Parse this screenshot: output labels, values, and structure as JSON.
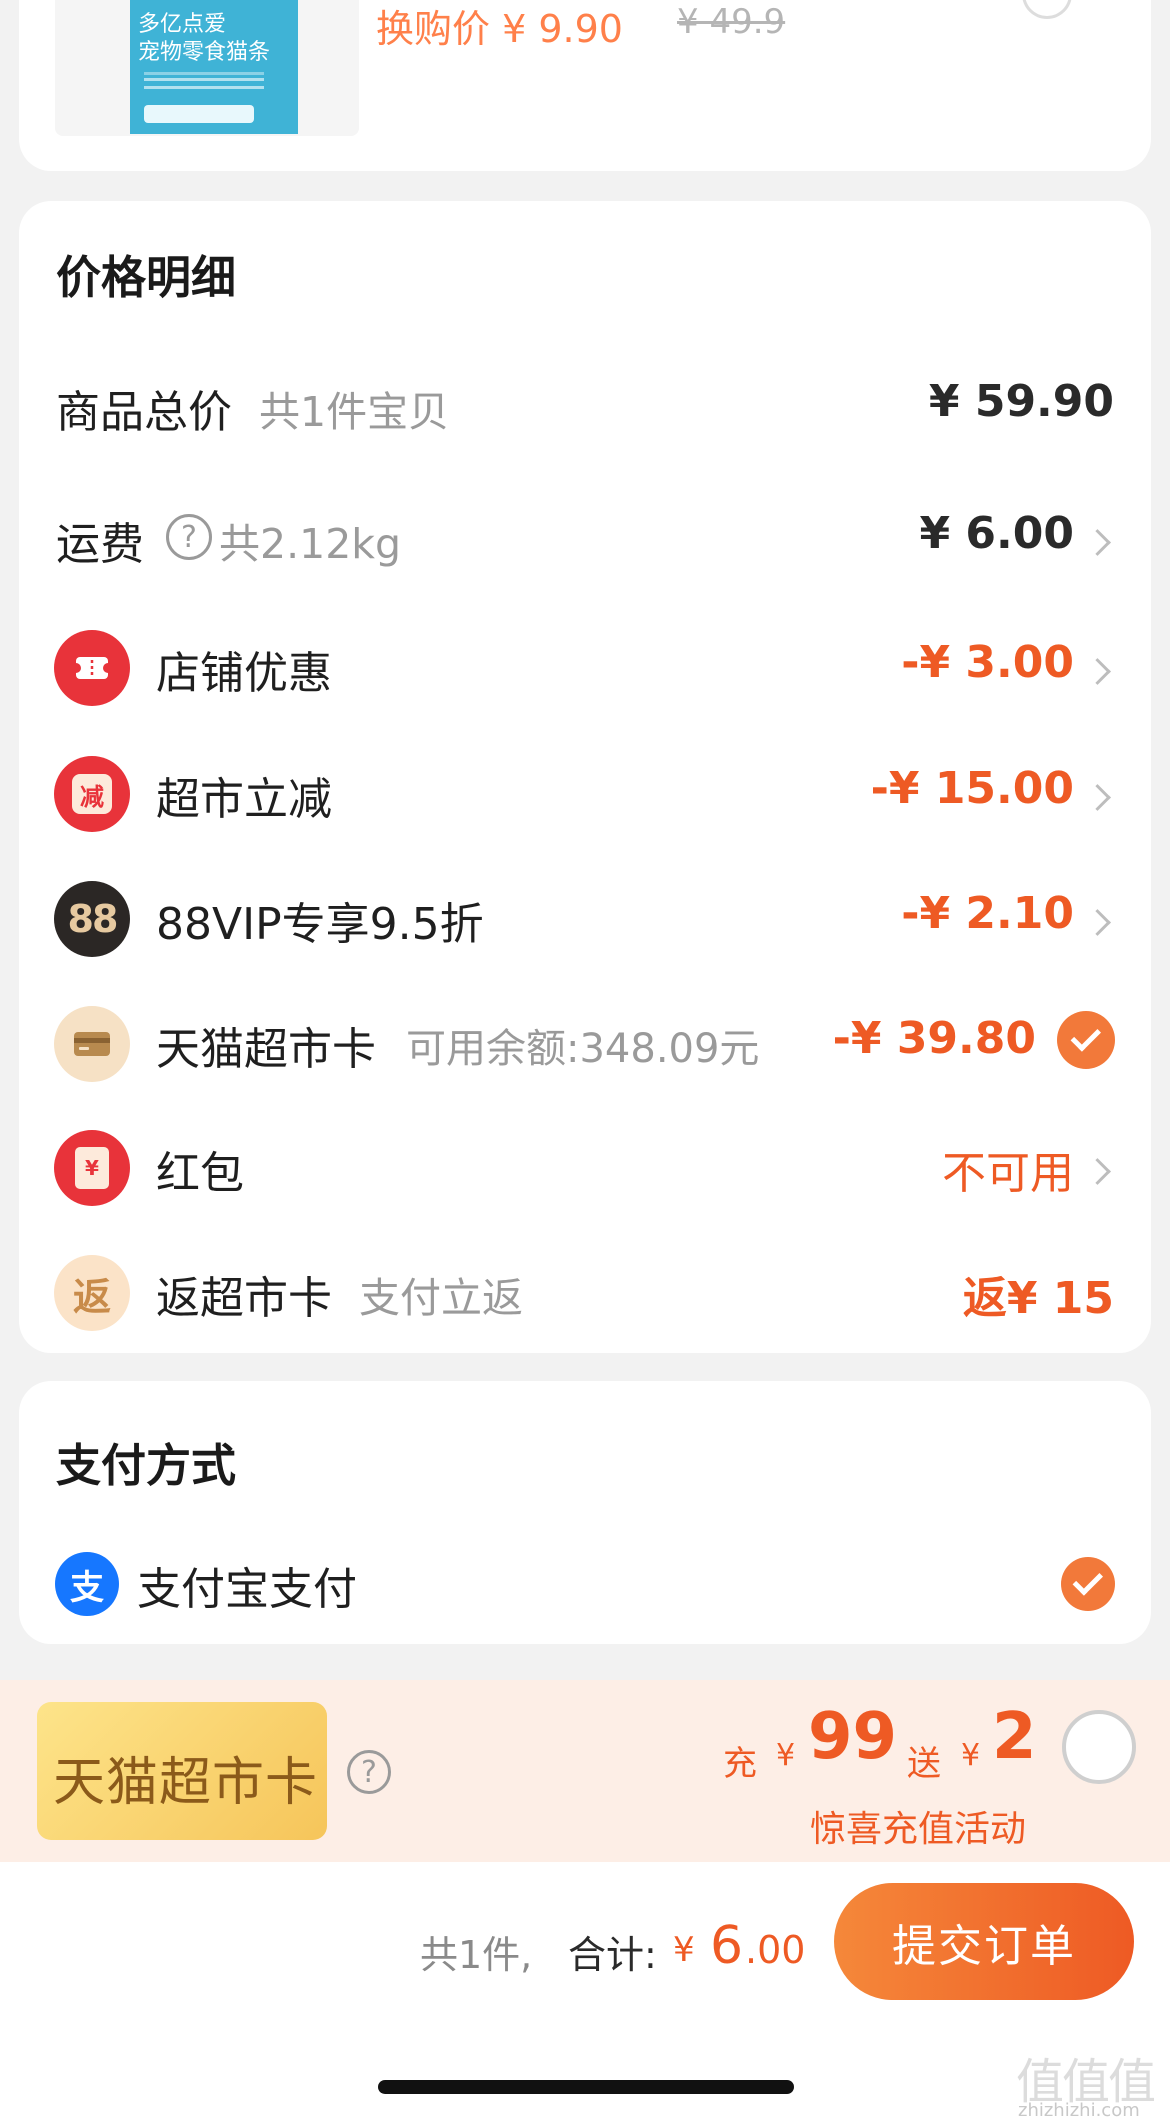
{
  "product": {
    "pack_lines": [
      "多亿点爱",
      "宠物零食猫条"
    ],
    "trade_price": "换购价 ¥ 9.90",
    "original_price": "¥ 49.9"
  },
  "price_detail": {
    "title": "价格明细",
    "rows": {
      "total": {
        "label": "商品总价",
        "sub": "共1件宝贝",
        "amount": "¥ 59.90"
      },
      "shipping": {
        "label": "运费",
        "help": "?",
        "sub": "共2.12kg",
        "amount": "¥ 6.00"
      },
      "shop_discount": {
        "label": "店铺优惠",
        "amount": "-¥ 3.00"
      },
      "supermarket_cut": {
        "label": "超市立减",
        "icon_text": "减",
        "amount": "-¥ 15.00"
      },
      "vip": {
        "label": "88VIP专享9.5折",
        "icon_text": "88",
        "amount": "-¥ 2.10"
      },
      "tmall_card": {
        "label": "天猫超市卡",
        "sub": "可用余额:348.09元",
        "amount": "-¥ 39.80"
      },
      "red_packet": {
        "label": "红包",
        "icon_text": "¥",
        "amount": "不可用"
      },
      "cashback": {
        "label": "返超市卡",
        "icon_text": "返",
        "sub": "支付立返",
        "amount": "返¥ 15"
      }
    }
  },
  "payment": {
    "title": "支付方式",
    "method": "支付宝支付",
    "icon_text": "支"
  },
  "promo": {
    "card_label": "天猫超市卡",
    "help": "?",
    "charge_word": "充",
    "charge_currency": "¥",
    "charge_amount": "99",
    "bonus_word": "送",
    "bonus_currency": "¥",
    "bonus_amount": "2",
    "subtitle": "惊喜充值活动"
  },
  "footer": {
    "count_text": "共1件,",
    "total_label": "合计:",
    "currency": "¥",
    "total_int": "6",
    "total_dec": ".00",
    "submit_label": "提交订单",
    "watermark": "zhizhizhi.com",
    "watermark_glyphs": "值值值"
  },
  "colors": {
    "accent_orange": "#ee5a24",
    "check_orange": "#f2793a",
    "shop_icon_red": "#e8333a",
    "vip_dark": "#2b2725",
    "alipay_blue": "#1677ff",
    "promo_bg": "#fdeee6"
  },
  "icons": [
    "ticket-icon",
    "discount-icon",
    "vip88-icon",
    "card-icon",
    "red-packet-icon",
    "cashback-icon",
    "alipay-icon",
    "help-icon",
    "chevron-right-icon",
    "check-icon"
  ]
}
